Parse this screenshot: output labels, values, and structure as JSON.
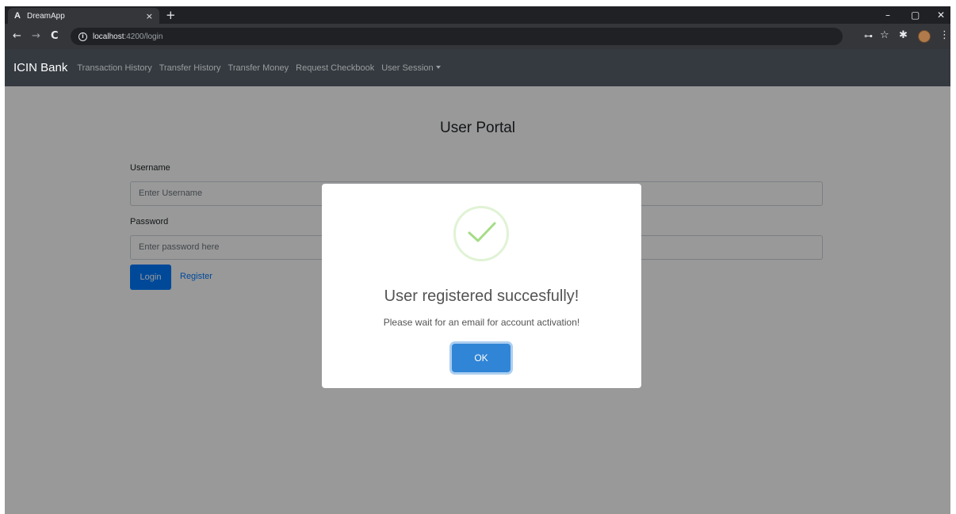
{
  "browser": {
    "tab": {
      "favicon": "A",
      "title": "DreamApp",
      "close": "×"
    },
    "new_tab": "+",
    "window_controls": {
      "minimize": "–",
      "maximize": "▢",
      "close": "✕"
    },
    "nav": {
      "back": "←",
      "forward": "→",
      "reload": "C"
    },
    "url": {
      "host": "localhost",
      "rest": ":4200/login"
    },
    "toolbar_icons": {
      "key": "⊶",
      "star": "☆",
      "extensions": "✱",
      "menu": "⋮"
    }
  },
  "navbar": {
    "brand": "ICIN Bank",
    "links": [
      "Transaction History",
      "Transfer History",
      "Transfer Money",
      "Request Checkbook"
    ],
    "dropdown": "User Session"
  },
  "form": {
    "title": "User Portal",
    "username_label": "Username",
    "username_placeholder": "Enter Username",
    "password_label": "Password",
    "password_placeholder": "Enter password here",
    "login_label": "Login",
    "register_label": "Register"
  },
  "modal": {
    "icon": "success-check-icon",
    "title": "User registered succesfully!",
    "text": "Please wait for an email for account activation!",
    "ok_label": "OK"
  },
  "colors": {
    "navbar_bg": "#343a40",
    "primary": "#007bff",
    "modal_button": "#3085d6",
    "success": "#a5dc86"
  }
}
